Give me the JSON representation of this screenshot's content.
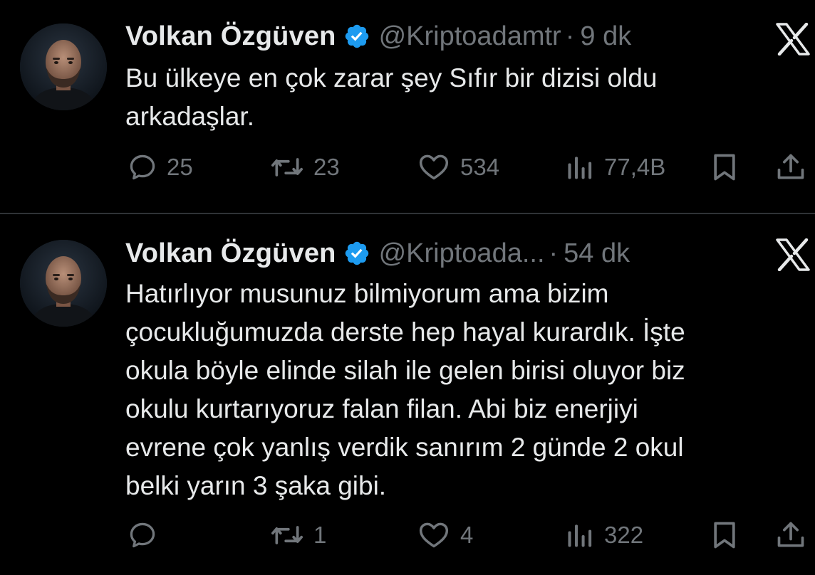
{
  "colors": {
    "background": "#000000",
    "text_primary": "#e7e9ea",
    "text_secondary": "#71767b",
    "verified_blue": "#1d9bf0",
    "divider": "#2f3336"
  },
  "tweets": [
    {
      "author_name": "Volkan Özgüven",
      "verified": true,
      "handle": "@Kriptoadamtr",
      "separator": "·",
      "time": "9 dk",
      "text": "Bu ülkeye en çok zarar şey Sıfır bir dizisi oldu\narkadaşlar.",
      "actions": {
        "reply_icon": "reply-icon",
        "reply_count": "25",
        "retweet_icon": "retweet-icon",
        "retweet_count": "23",
        "like_icon": "heart-icon",
        "like_count": "534",
        "views_icon": "views-icon",
        "views_count": "77,4B",
        "bookmark_icon": "bookmark-icon",
        "share_icon": "share-icon"
      }
    },
    {
      "author_name": "Volkan Özgüven",
      "verified": true,
      "handle": "@Kriptoada...",
      "separator": "·",
      "time": "54 dk",
      "text": "Hatırlıyor musunuz bilmiyorum ama bizim\nçocukluğumuzda derste hep hayal kurardık. İşte\nokula böyle elinde silah ile gelen birisi oluyor biz\nokulu kurtarıyoruz falan filan. Abi biz enerjiyi\nevrene çok yanlış verdik sanırım 2 günde 2 okul\nbelki yarın 3 şaka gibi.",
      "actions": {
        "reply_icon": "reply-icon",
        "reply_count": "",
        "retweet_icon": "retweet-icon",
        "retweet_count": "1",
        "like_icon": "heart-icon",
        "like_count": "4",
        "views_icon": "views-icon",
        "views_count": "322",
        "bookmark_icon": "bookmark-icon",
        "share_icon": "share-icon"
      }
    }
  ]
}
